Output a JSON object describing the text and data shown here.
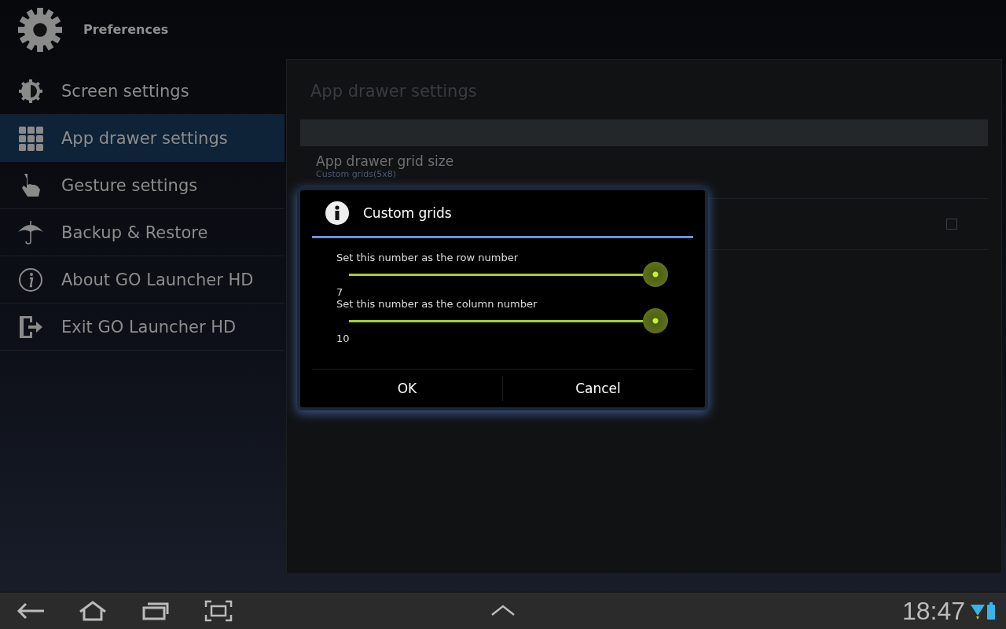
{
  "header": {
    "title": "Preferences"
  },
  "sidebar": {
    "items": [
      {
        "label": "Screen settings",
        "kind": "brightness",
        "selected": false
      },
      {
        "label": "App drawer settings",
        "kind": "grid",
        "selected": true
      },
      {
        "label": "Gesture settings",
        "kind": "gesture",
        "selected": false
      },
      {
        "label": "Backup & Restore",
        "kind": "umbrella",
        "selected": false
      },
      {
        "label": "About GO Launcher HD",
        "kind": "info",
        "selected": false
      },
      {
        "label": "Exit GO Launcher HD",
        "kind": "exit",
        "selected": false
      }
    ]
  },
  "panel": {
    "title": "App drawer settings",
    "rows": [
      {
        "kind": "text",
        "title": "App drawer grid size",
        "summary": "Custom grids(5x8)"
      },
      {
        "kind": "checkbox",
        "checked": false
      }
    ]
  },
  "dialog": {
    "title": "Custom grids",
    "sliders": [
      {
        "label": "Set this number as the row number",
        "level": 1,
        "reading": "7"
      },
      {
        "label": "Set this number as the column number",
        "level": 1,
        "reading": "10"
      }
    ],
    "buttons": [
      "OK",
      "Cancel"
    ]
  },
  "nav_bar": {
    "time": "18:47"
  }
}
